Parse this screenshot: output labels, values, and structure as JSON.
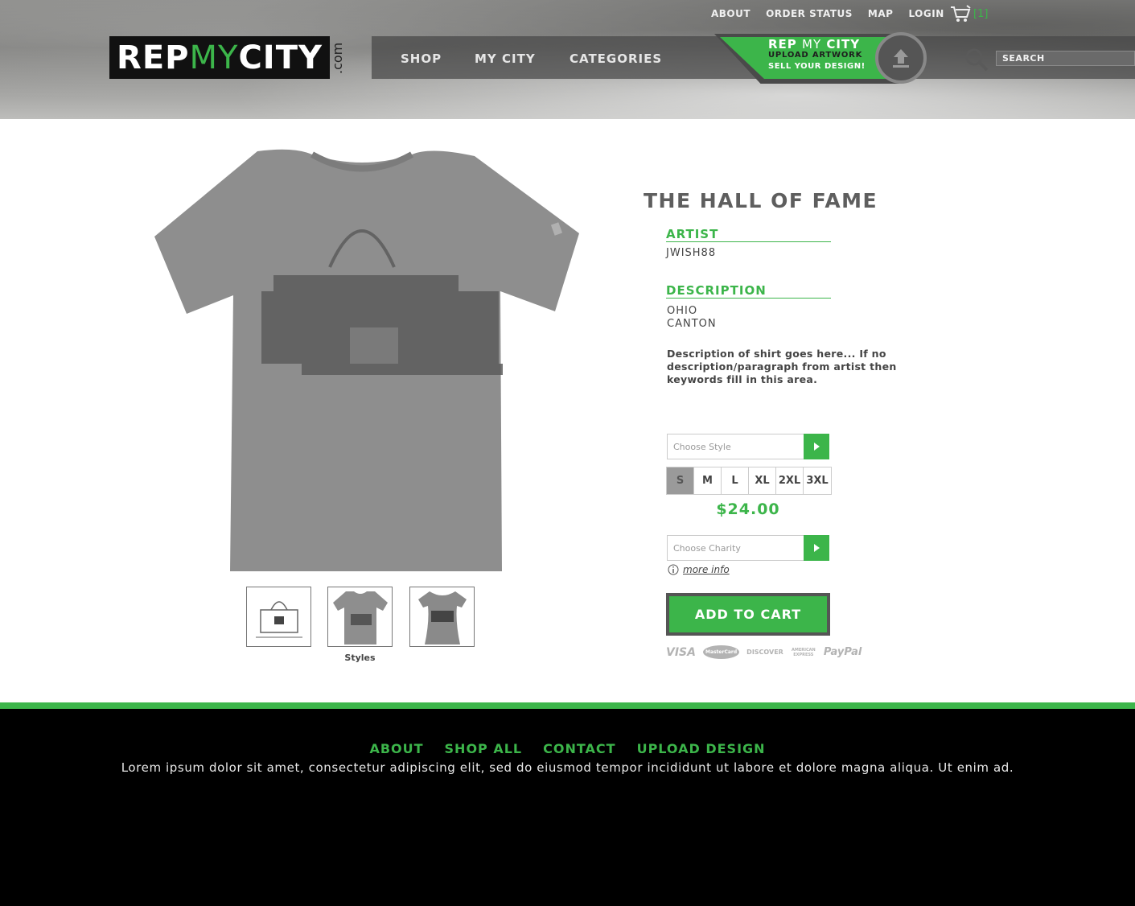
{
  "top_links": [
    "ABOUT",
    "ORDER STATUS",
    "MAP",
    "LOGIN"
  ],
  "cart": {
    "count": "[1]"
  },
  "logo": {
    "rep": "REP",
    "my": "MY",
    "city": "CITY",
    "com": ".com"
  },
  "nav": {
    "items": [
      "SHOP",
      "MY CITY",
      "CATEGORIES"
    ]
  },
  "upload_banner": {
    "line1_bold": "REP",
    "line1_thin": "MY",
    "line1_city": "CITY",
    "line2": "UPLOAD ARTWORK",
    "line3": "SELL YOUR DESIGN!"
  },
  "search": {
    "placeholder": "SEARCH"
  },
  "product": {
    "title": "THE HALL OF FAME",
    "artist_label": "ARTIST",
    "artist": "JWISH88",
    "description_label": "DESCRIPTION",
    "state": "OHIO",
    "city": "CANTON",
    "description": "Description of shirt goes here... If no description/paragraph from artist then keywords fill in this area.",
    "style_placeholder": "Choose Style",
    "sizes": [
      "S",
      "M",
      "L",
      "XL",
      "2XL",
      "3XL"
    ],
    "selected_size": "S",
    "price": "$24.00",
    "charity_placeholder": "Choose Charity",
    "more_info": "more info",
    "add_to_cart": "ADD TO CART",
    "thumb_caption": "Styles",
    "payments": [
      "VISA",
      "MasterCard",
      "DISCOVER",
      "AMERICAN EXPRESS",
      "PayPal"
    ]
  },
  "footer": {
    "links": [
      "ABOUT",
      "SHOP ALL",
      "CONTACT",
      "UPLOAD DESIGN"
    ],
    "text": "Lorem ipsum dolor sit amet, consectetur adipiscing elit, sed do eiusmod tempor incididunt ut labore et dolore magna aliqua. Ut enim ad."
  },
  "colors": {
    "accent": "#3cb54a",
    "dark": "#111111",
    "footer_bg": "#000000"
  }
}
